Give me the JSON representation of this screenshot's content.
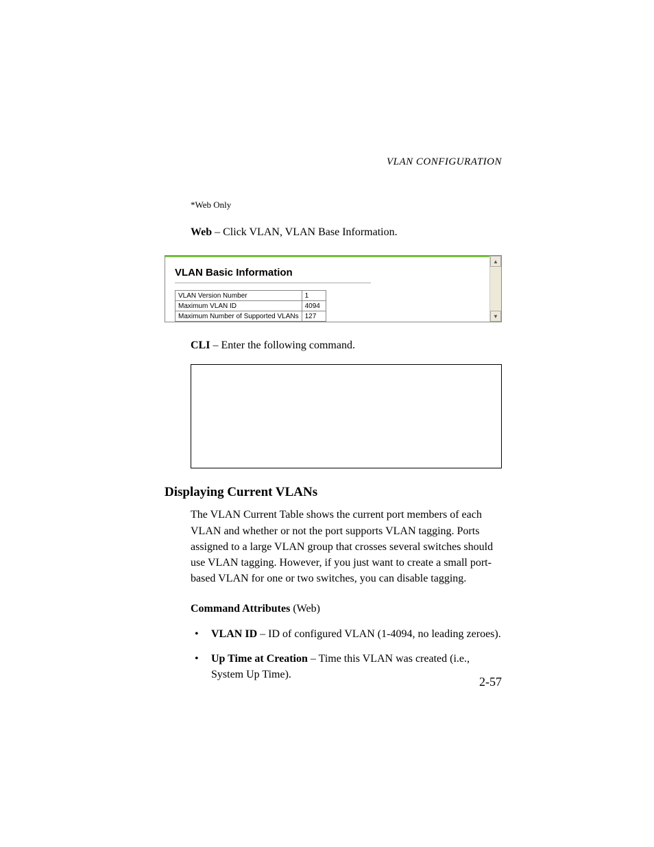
{
  "header": {
    "running": "VLAN CONFIGURATION"
  },
  "footnote": "*Web Only",
  "web_line": {
    "bold": "Web",
    "rest": " – Click VLAN, VLAN Base Information."
  },
  "figure": {
    "title": "VLAN Basic Information",
    "rows": [
      {
        "label": "VLAN Version Number",
        "value": "1"
      },
      {
        "label": "Maximum VLAN ID",
        "value": "4094"
      },
      {
        "label": "Maximum Number of Supported VLANs",
        "value": "127"
      }
    ],
    "scroll_up": "▲",
    "scroll_down": "▼"
  },
  "cli_line": {
    "bold": "CLI",
    "rest": " – Enter the following command."
  },
  "section_heading": "Displaying Current VLANs",
  "section_para": "The VLAN Current Table shows the current port members of each VLAN and whether or not the port supports VLAN tagging. Ports assigned to a large VLAN group that crosses several switches should use VLAN tagging. However, if you just want to create a small port-based VLAN for one or two switches, you can disable tagging.",
  "command_attr": {
    "bold": "Command Attributes",
    "paren": " (Web)"
  },
  "bullets": [
    {
      "bold": "VLAN ID",
      "rest": " – ID of configured VLAN (1-4094, no leading zeroes)."
    },
    {
      "bold": "Up Time at Creation",
      "rest": " – Time this VLAN was created (i.e., System Up Time)."
    }
  ],
  "page_number": "2-57"
}
